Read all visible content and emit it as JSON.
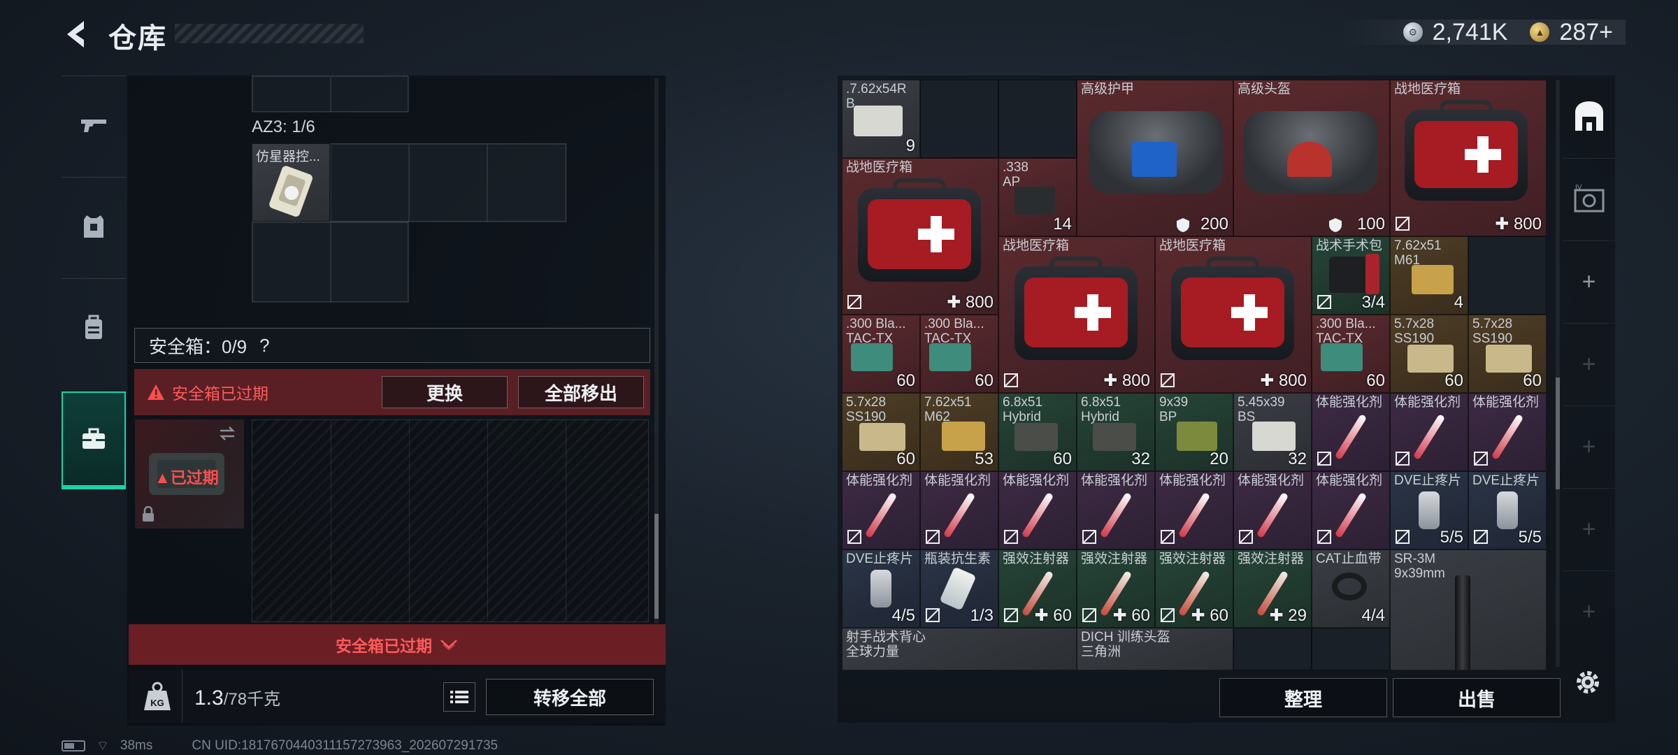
{
  "header": {
    "title": "仓库",
    "currency": [
      {
        "icon": "silver-coin-icon",
        "value": "2,741K"
      },
      {
        "icon": "gold-coin-icon",
        "value": "287+"
      }
    ]
  },
  "left_nav": [
    "gun-icon",
    "armor-vest-icon",
    "backpack-icon",
    "safebox-icon"
  ],
  "left_panel": {
    "az3_label": "AZ3: 1/6",
    "az3_item": "仿星器控...",
    "safebox_label": "安全箱：0/9",
    "help": "?",
    "expired_warning": "安全箱已过期",
    "replace_button": "更换",
    "remove_all_button": "全部移出",
    "thumb_status": "已过期",
    "footer_text": "安全箱已过期",
    "weight_current": "1.3",
    "weight_capacity": "/78千克",
    "kg_label": "KG",
    "transfer_all_button": "转移全部"
  },
  "inventory": {
    "slots": [
      {
        "name": ".7.62x54R",
        "name2": "B",
        "qty": "9"
      },
      {
        "name": "高级护甲",
        "qty": "200"
      },
      {
        "name": "高级头盔",
        "qty": "100"
      },
      {
        "name": "战地医疗箱",
        "qty": "800"
      },
      {
        "name": "战地医疗箱",
        "qty": "800"
      },
      {
        "name": ".338",
        "name2": "AP",
        "qty": "14"
      },
      {
        "name": "战地医疗箱",
        "qty": "800"
      },
      {
        "name": "战地医疗箱",
        "qty": "800"
      },
      {
        "name": "战术手术包",
        "qty": "3/4"
      },
      {
        "name": "7.62x51",
        "name2": "M61",
        "qty": "4"
      },
      {
        "name": ".300 Bla...",
        "name2": "TAC-TX",
        "qty": "60"
      },
      {
        "name": ".300 Bla...",
        "name2": "TAC-TX",
        "qty": "60"
      },
      {
        "name": ".300 Bla...",
        "name2": "TAC-TX",
        "qty": "60"
      },
      {
        "name": "5.7x28",
        "name2": "SS190",
        "qty": "60"
      },
      {
        "name": "5.7x28",
        "name2": "SS190",
        "qty": "60"
      },
      {
        "name": "5.7x28",
        "name2": "SS190",
        "qty": "60"
      },
      {
        "name": "7.62x51",
        "name2": "M62",
        "qty": "53"
      },
      {
        "name": "6.8x51",
        "name2": "Hybrid",
        "qty": "60"
      },
      {
        "name": "6.8x51",
        "name2": "Hybrid",
        "qty": "32"
      },
      {
        "name": "9x39",
        "name2": "BP",
        "qty": "20"
      },
      {
        "name": "5.45x39",
        "name2": "BS",
        "qty": "32"
      },
      {
        "name": "体能强化剂"
      },
      {
        "name": "体能强化剂"
      },
      {
        "name": "体能强化剂"
      },
      {
        "name": "体能强化剂"
      },
      {
        "name": "体能强化剂"
      },
      {
        "name": "体能强化剂"
      },
      {
        "name": "体能强化剂"
      },
      {
        "name": "体能强化剂"
      },
      {
        "name": "体能强化剂"
      },
      {
        "name": "体能强化剂"
      },
      {
        "name": "DVE止疼片",
        "qty": "5/5"
      },
      {
        "name": "DVE止疼片",
        "qty": "5/5"
      },
      {
        "name": "DVE止疼片",
        "qty": "4/5"
      },
      {
        "name": "瓶装抗生素",
        "qty": "1/3"
      },
      {
        "name": "强效注射器",
        "qty": "60"
      },
      {
        "name": "强效注射器",
        "qty": "60"
      },
      {
        "name": "强效注射器",
        "qty": "60"
      },
      {
        "name": "强效注射器",
        "qty": "29"
      },
      {
        "name": "CAT止血带",
        "qty": "4/4"
      },
      {
        "name": "SR-3M",
        "name2": "9x39mm"
      },
      {
        "name": "射手战术背心",
        "name2": "全球力量"
      },
      {
        "name": "DICH 训练头盔",
        "name2": "三角洲"
      }
    ]
  },
  "right_buttons": {
    "organize": "整理",
    "sell": "出售"
  },
  "right_rail": [
    "warehouse-icon",
    "vault-icon",
    "add",
    "add",
    "add",
    "add",
    "add"
  ],
  "status": {
    "ping": "38ms",
    "uid": "CN UID:1817670440311157273963_202607291735"
  },
  "colors": {
    "accent": "#1bd3a7",
    "danger": "#ff4d4d",
    "danger_bg": "#6a1f24"
  }
}
